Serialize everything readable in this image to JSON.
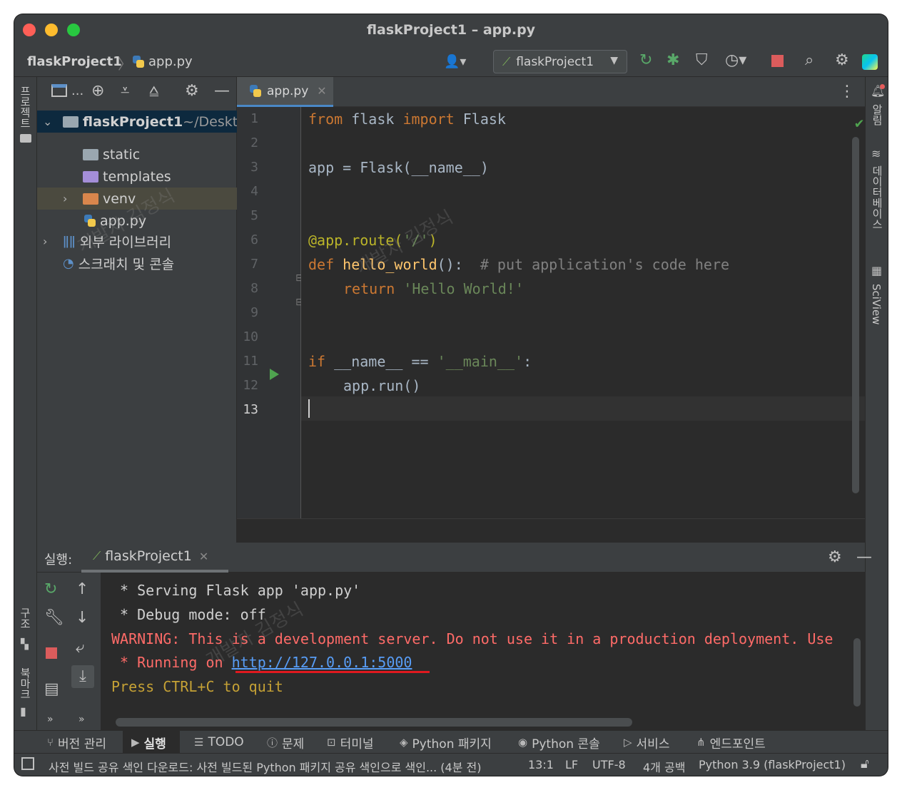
{
  "window": {
    "title": "flaskProject1 – app.py"
  },
  "navbar": {
    "project": "flaskProject1",
    "separator": "〉",
    "file": "app.py",
    "run_config": "flaskProject1"
  },
  "left_strip": {
    "project_label": "프로젝트",
    "structure_label": "구조",
    "bookmarks_label": "북마크"
  },
  "right_strip": {
    "notifications_label": "알림",
    "database_label": "데이터베이스",
    "sciview_label": "SciView"
  },
  "project_panel": {
    "toolbar_dots": "...",
    "tree": [
      {
        "label": "flaskProject1",
        "suffix": " ~/Desktop"
      },
      {
        "label": "static"
      },
      {
        "label": "templates"
      },
      {
        "label": "venv"
      },
      {
        "label": "app.py"
      },
      {
        "label": "외부 라이브러리"
      },
      {
        "label": "스크래치 및 콘솔"
      }
    ]
  },
  "editor": {
    "tab_label": "app.py",
    "line_numbers": [
      "1",
      "2",
      "3",
      "4",
      "5",
      "6",
      "7",
      "8",
      "9",
      "10",
      "11",
      "12",
      "13"
    ],
    "code": {
      "l1_kw1": "from",
      "l1_mod": " flask ",
      "l1_kw2": "import",
      "l1_cls": " Flask",
      "l3": "app = Flask(__name__)",
      "l6_dec": "@app.route(",
      "l6_str": "'/'",
      "l6_end": ")",
      "l7_kw": "def",
      "l7_fn": " hello_world",
      "l7_par": "():  ",
      "l7_cm": "# put application's code here",
      "l8_kw": "return",
      "l8_str": " 'Hello World!'",
      "l11_kw": "if",
      "l11_mid": " __name__ == ",
      "l11_str": "'__main__'",
      "l11_end": ":",
      "l12": "app.run()"
    }
  },
  "run_panel": {
    "label": "실행:",
    "tab_label": "flaskProject1",
    "console": {
      "line1": " * Serving Flask app 'app.py'",
      "line2": " * Debug mode: off",
      "warning": "WARNING: This is a development server. Do not use it in a production deployment. Use",
      "running_prefix": " * Running on ",
      "url": "http://127.0.0.1:5000",
      "quit": "Press CTRL+C to quit"
    }
  },
  "tool_tabs": [
    {
      "label": "버전 관리"
    },
    {
      "label": "실행"
    },
    {
      "label": "TODO"
    },
    {
      "label": "문제"
    },
    {
      "label": "터미널"
    },
    {
      "label": "Python 패키지"
    },
    {
      "label": "Python 콘솔"
    },
    {
      "label": "서비스"
    },
    {
      "label": "엔드포인트"
    }
  ],
  "status_bar": {
    "message": "사전 빌드 공유 색인 다운로드: 사전 빌드된 Python 패키지 공유 색인으로 색인... (4분 전)",
    "position": "13:1",
    "line_sep": "LF",
    "encoding": "UTF-8",
    "indent": "4개 공백",
    "interpreter": "Python 3.9 (flaskProject1)"
  },
  "watermark": "개발자 김정식",
  "colors": {
    "bg": "#2b2b2b",
    "panel": "#3c3f41",
    "keyword": "#cc7832",
    "function": "#ffc66d",
    "string": "#6a8759",
    "comment": "#808080",
    "decorator": "#bbb529",
    "warning": "#ff6b68",
    "link": "#589df6"
  }
}
